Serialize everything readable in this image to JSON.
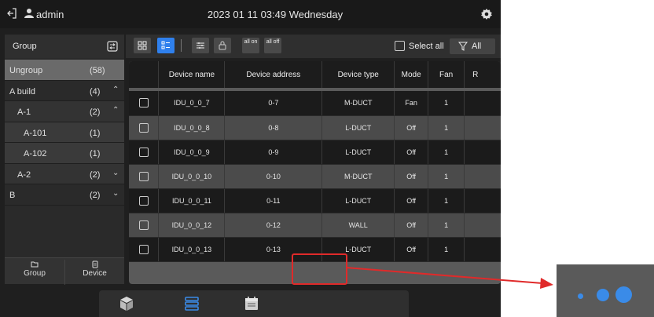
{
  "topbar": {
    "username": "admin",
    "datetime": "2023 01 11 03:49 Wednesday"
  },
  "sidebar": {
    "header": "Group",
    "items": [
      {
        "label": "Ungroup",
        "count": "(58)",
        "chevron": ""
      },
      {
        "label": "A build",
        "count": "(4)",
        "chevron": "^"
      },
      {
        "label": "A-1",
        "count": "(2)",
        "chevron": "^"
      },
      {
        "label": "A-101",
        "count": "(1)",
        "chevron": ""
      },
      {
        "label": "A-102",
        "count": "(1)",
        "chevron": ""
      },
      {
        "label": "A-2",
        "count": "(2)",
        "chevron": "v"
      },
      {
        "label": "B",
        "count": "(2)",
        "chevron": "v"
      }
    ],
    "bottom": {
      "group_label": "Group",
      "device_label": "Device"
    }
  },
  "toolbar": {
    "all_on": "all on",
    "all_off": "all off",
    "select_all_label": "Select all",
    "filter_label": "All"
  },
  "table": {
    "headers": [
      "",
      "Device name",
      "Device address",
      "Device type",
      "Mode",
      "Fan",
      "R"
    ],
    "rows": [
      {
        "name": "IDU_0_0_7",
        "address": "0-7",
        "type": "M-DUCT",
        "mode": "Fan",
        "fan": "1"
      },
      {
        "name": "IDU_0_0_8",
        "address": "0-8",
        "type": "L-DUCT",
        "mode": "Off",
        "fan": "1"
      },
      {
        "name": "IDU_0_0_9",
        "address": "0-9",
        "type": "L-DUCT",
        "mode": "Off",
        "fan": "1"
      },
      {
        "name": "IDU_0_0_10",
        "address": "0-10",
        "type": "M-DUCT",
        "mode": "Off",
        "fan": "1"
      },
      {
        "name": "IDU_0_0_11",
        "address": "0-11",
        "type": "L-DUCT",
        "mode": "Off",
        "fan": "1"
      },
      {
        "name": "IDU_0_0_12",
        "address": "0-12",
        "type": "WALL",
        "mode": "Off",
        "fan": "1"
      },
      {
        "name": "IDU_0_0_13",
        "address": "0-13",
        "type": "L-DUCT",
        "mode": "Off",
        "fan": "1"
      }
    ]
  },
  "colors": {
    "accent": "#2f80ed",
    "highlight": "#e02a2a",
    "dot": "#3a8be8"
  },
  "icons": [
    "logout-icon",
    "user-icon",
    "gear-icon",
    "group-toggle-icon",
    "grid-view-icon",
    "list-view-icon",
    "filter-settings-icon",
    "lock-icon",
    "filter-icon",
    "folder-icon",
    "device-icon",
    "cube-icon",
    "list-stack-icon",
    "calendar-icon"
  ]
}
